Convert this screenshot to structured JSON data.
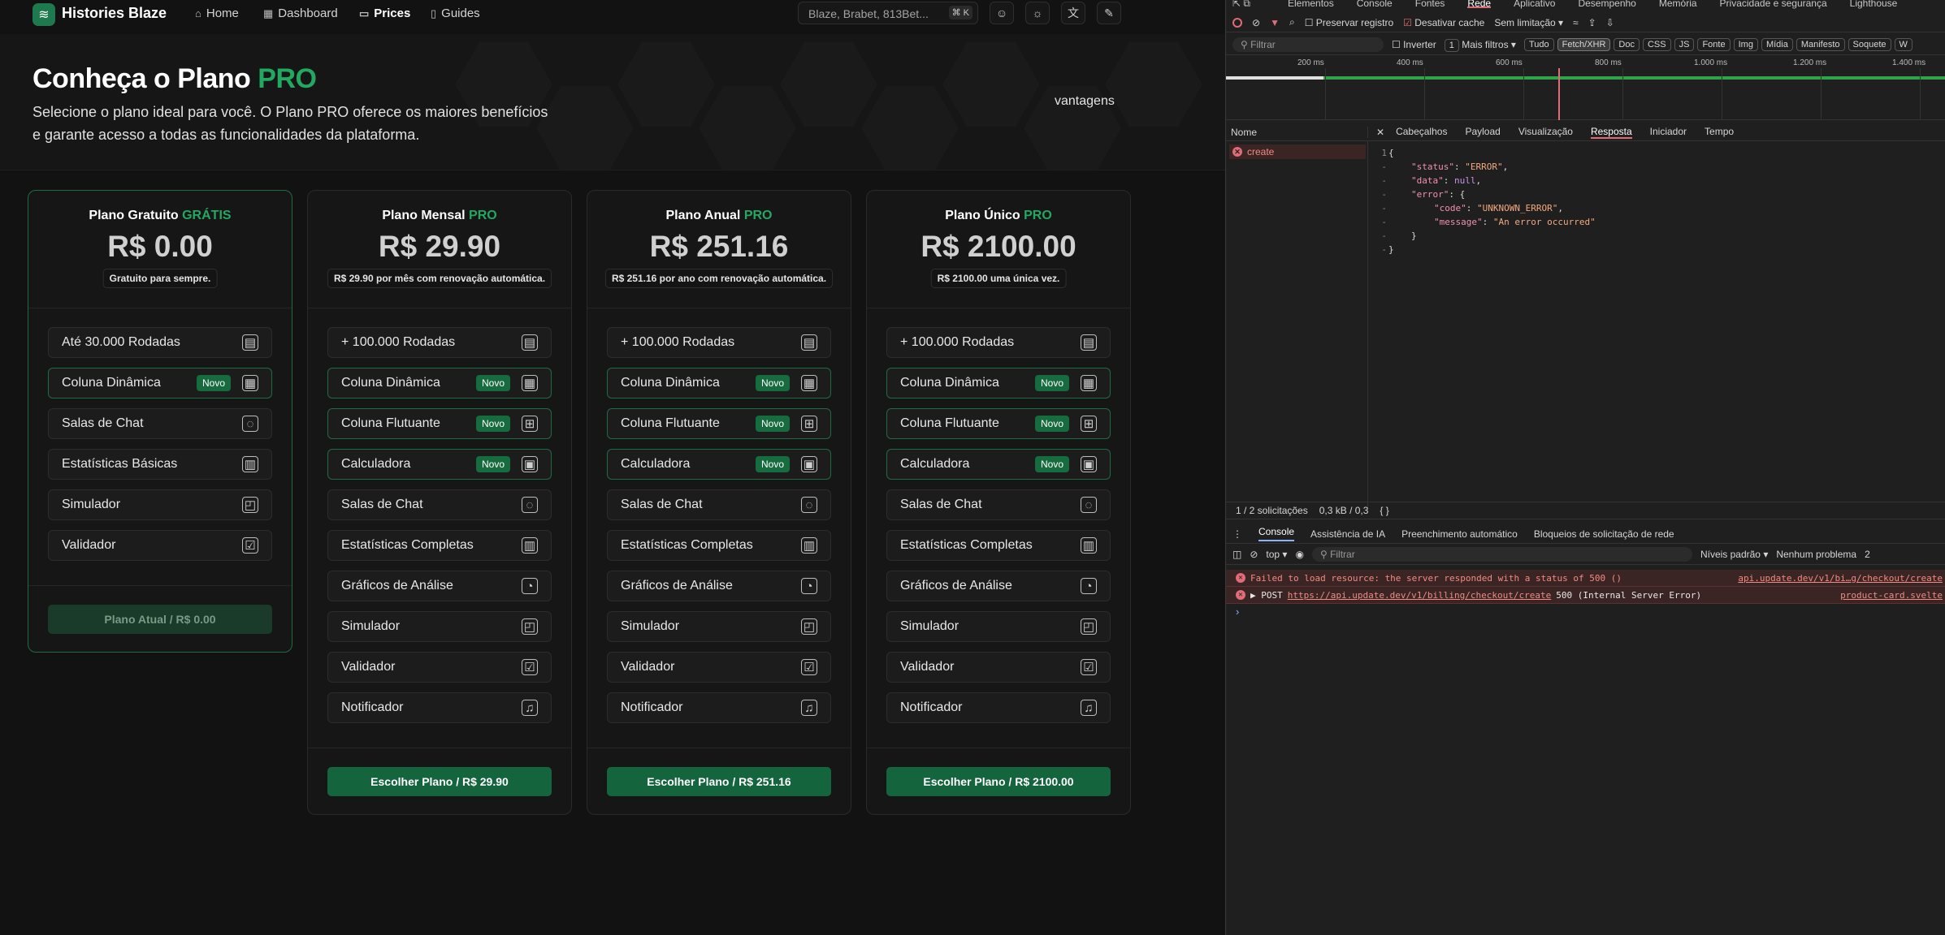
{
  "nav": {
    "brand": "Histories Blaze",
    "links": [
      {
        "label": "Home",
        "icon": "home-icon"
      },
      {
        "label": "Dashboard",
        "icon": "dashboard-icon"
      },
      {
        "label": "Prices",
        "icon": "prices-icon"
      },
      {
        "label": "Guides",
        "icon": "book-icon"
      }
    ],
    "search_placeholder": "Blaze, Brabet, 813Bet...",
    "search_kbd": "⌘ K"
  },
  "hero": {
    "title_main": "Conheça o Plano",
    "title_accent": "PRO",
    "description": "Selecione o plano ideal para você. O Plano PRO oferece os maiores benefícios e garante acesso a todas as funcionalidades da plataforma.",
    "vantagens": "vantagens"
  },
  "plans": [
    {
      "title": "Plano Gratuito",
      "tag": "GRÁTIS",
      "price": "R$ 0.00",
      "subtitle": "Gratuito para sempre.",
      "features": [
        {
          "label": "Até 30.000 Rodadas",
          "new": false,
          "icon": "table-icon"
        },
        {
          "label": "Coluna Dinâmica",
          "new": true,
          "icon": "layout-icon"
        },
        {
          "label": "Salas de Chat",
          "new": false,
          "icon": "chat-icon"
        },
        {
          "label": "Estatísticas Básicas",
          "new": false,
          "icon": "bar-chart-icon"
        },
        {
          "label": "Simulador",
          "new": false,
          "icon": "simulator-icon"
        },
        {
          "label": "Validador",
          "new": false,
          "icon": "checklist-icon"
        }
      ],
      "cta": "Plano Atual / R$ 0.00"
    },
    {
      "title": "Plano Mensal",
      "tag": "PRO",
      "price": "R$ 29.90",
      "subtitle": "R$ 29.90 por mês com renovação automática.",
      "features": [
        {
          "label": "+ 100.000 Rodadas",
          "new": false,
          "icon": "table-icon"
        },
        {
          "label": "Coluna Dinâmica",
          "new": true,
          "icon": "layout-icon"
        },
        {
          "label": "Coluna Flutuante",
          "new": true,
          "icon": "grid-icon"
        },
        {
          "label": "Calculadora",
          "new": true,
          "icon": "calculator-icon"
        },
        {
          "label": "Salas de Chat",
          "new": false,
          "icon": "chat-icon"
        },
        {
          "label": "Estatísticas Completas",
          "new": false,
          "icon": "bar-chart-icon"
        },
        {
          "label": "Gráficos de Análise",
          "new": false,
          "icon": "pie-chart-icon"
        },
        {
          "label": "Simulador",
          "new": false,
          "icon": "simulator-icon"
        },
        {
          "label": "Validador",
          "new": false,
          "icon": "checklist-icon"
        },
        {
          "label": "Notificador",
          "new": false,
          "icon": "bell-icon"
        }
      ],
      "cta": "Escolher Plano / R$ 29.90"
    },
    {
      "title": "Plano Anual",
      "tag": "PRO",
      "price": "R$ 251.16",
      "subtitle": "R$ 251.16 por ano com renovação automática.",
      "features": [
        {
          "label": "+ 100.000 Rodadas",
          "new": false,
          "icon": "table-icon"
        },
        {
          "label": "Coluna Dinâmica",
          "new": true,
          "icon": "layout-icon"
        },
        {
          "label": "Coluna Flutuante",
          "new": true,
          "icon": "grid-icon"
        },
        {
          "label": "Calculadora",
          "new": true,
          "icon": "calculator-icon"
        },
        {
          "label": "Salas de Chat",
          "new": false,
          "icon": "chat-icon"
        },
        {
          "label": "Estatísticas Completas",
          "new": false,
          "icon": "bar-chart-icon"
        },
        {
          "label": "Gráficos de Análise",
          "new": false,
          "icon": "pie-chart-icon"
        },
        {
          "label": "Simulador",
          "new": false,
          "icon": "simulator-icon"
        },
        {
          "label": "Validador",
          "new": false,
          "icon": "checklist-icon"
        },
        {
          "label": "Notificador",
          "new": false,
          "icon": "bell-icon"
        }
      ],
      "cta": "Escolher Plano / R$ 251.16"
    },
    {
      "title": "Plano Único",
      "tag": "PRO",
      "price": "R$ 2100.00",
      "subtitle": "R$ 2100.00 uma única vez.",
      "features": [
        {
          "label": "+ 100.000 Rodadas",
          "new": false,
          "icon": "table-icon"
        },
        {
          "label": "Coluna Dinâmica",
          "new": true,
          "icon": "layout-icon"
        },
        {
          "label": "Coluna Flutuante",
          "new": true,
          "icon": "grid-icon"
        },
        {
          "label": "Calculadora",
          "new": true,
          "icon": "calculator-icon"
        },
        {
          "label": "Salas de Chat",
          "new": false,
          "icon": "chat-icon"
        },
        {
          "label": "Estatísticas Completas",
          "new": false,
          "icon": "bar-chart-icon"
        },
        {
          "label": "Gráficos de Análise",
          "new": false,
          "icon": "pie-chart-icon"
        },
        {
          "label": "Simulador",
          "new": false,
          "icon": "simulator-icon"
        },
        {
          "label": "Validador",
          "new": false,
          "icon": "checklist-icon"
        },
        {
          "label": "Notificador",
          "new": false,
          "icon": "bell-icon"
        }
      ],
      "cta": "Escolher Plano / R$ 2100.00"
    }
  ],
  "badge_new": "Novo",
  "devtools": {
    "tabs": [
      "Elementos",
      "Console",
      "Fontes",
      "Rede",
      "Aplicativo",
      "Desempenho",
      "Memória",
      "Privacidade e segurança",
      "Lighthouse"
    ],
    "active_tab": "Rede",
    "toolbar": {
      "preserve_log": "Preservar registro",
      "disable_cache": "Desativar cache",
      "throttle": "Sem limitação"
    },
    "filter": {
      "placeholder": "Filtrar",
      "invert": "Inverter",
      "more_count": "1",
      "more_filters": "Mais filtros"
    },
    "type_chips": [
      "Tudo",
      "Fetch/XHR",
      "Doc",
      "CSS",
      "JS",
      "Fonte",
      "Img",
      "Mídia",
      "Manifesto",
      "Soquete",
      "W"
    ],
    "active_chip": "Fetch/XHR",
    "timeline_ticks": [
      "200 ms",
      "400 ms",
      "600 ms",
      "800 ms",
      "1.000 ms",
      "1.200 ms",
      "1.400 ms"
    ],
    "name_header": "Nome",
    "detail_tabs": [
      "Cabeçalhos",
      "Payload",
      "Visualização",
      "Resposta",
      "Iniciador",
      "Tempo"
    ],
    "active_detail_tab": "Resposta",
    "request_name": "create",
    "gutter": [
      "1",
      "-",
      "-",
      "-",
      "-",
      "-",
      "-",
      "-"
    ],
    "response_lines": [
      {
        "indent": 0,
        "text": "{"
      },
      {
        "indent": 1,
        "key": "\"status\"",
        "value": "\"ERROR\"",
        "vtype": "s",
        "tail": ","
      },
      {
        "indent": 1,
        "key": "\"data\"",
        "value": "null",
        "vtype": "n",
        "tail": ","
      },
      {
        "indent": 1,
        "key": "\"error\"",
        "value": "{",
        "vtype": "p",
        "tail": ""
      },
      {
        "indent": 2,
        "key": "\"code\"",
        "value": "\"UNKNOWN_ERROR\"",
        "vtype": "s",
        "tail": ","
      },
      {
        "indent": 2,
        "key": "\"message\"",
        "value": "\"An error occurred\"",
        "vtype": "s",
        "tail": ""
      },
      {
        "indent": 1,
        "text": "}"
      },
      {
        "indent": 0,
        "text": "}"
      }
    ],
    "status_requests": "1 / 2 solicitações",
    "status_size": "0,3 kB / 0,3",
    "console_tabs": [
      "Console",
      "Assistência de IA",
      "Preenchimento automático",
      "Bloqueios de solicitação de rede"
    ],
    "console_bar": {
      "context": "top",
      "filter": "Filtrar",
      "levels": "Níveis padrão",
      "issues": "Nenhum problema",
      "issues_count": "2"
    },
    "messages": [
      {
        "text": "Failed to load resource: the server responded with a status of 500 ()",
        "source": "api.update.dev/v1/bi…g/checkout/create"
      },
      {
        "prefix": "▶ POST",
        "url": "https://api.update.dev/v1/billing/checkout/create",
        "rest": "500 (Internal Server Error)",
        "source": "product-card.svelte"
      }
    ],
    "prompt": "›"
  }
}
